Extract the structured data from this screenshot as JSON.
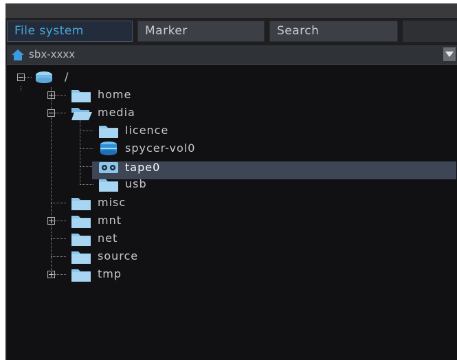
{
  "tabs": [
    {
      "label": "File system",
      "active": true
    },
    {
      "label": "Marker",
      "active": false
    },
    {
      "label": "Search",
      "active": false
    }
  ],
  "path_bar": {
    "label": "sbx-xxxx",
    "icon": "home-icon"
  },
  "tree": {
    "root": {
      "label": "/",
      "icon": "drive-icon",
      "expanded": true
    },
    "items": [
      {
        "label": "home",
        "icon": "folder-icon",
        "expander": "plus"
      },
      {
        "label": "media",
        "icon": "folder-open-icon",
        "expander": "minus"
      },
      {
        "label": "licence",
        "icon": "folder-icon"
      },
      {
        "label": "spycer-vol0",
        "icon": "volume-icon"
      },
      {
        "label": "tape0",
        "icon": "tape-icon",
        "selected": true
      },
      {
        "label": "usb",
        "icon": "folder-icon"
      },
      {
        "label": "misc",
        "icon": "folder-icon"
      },
      {
        "label": "mnt",
        "icon": "folder-icon",
        "expander": "plus"
      },
      {
        "label": "net",
        "icon": "folder-icon"
      },
      {
        "label": "source",
        "icon": "folder-icon"
      },
      {
        "label": "tmp",
        "icon": "folder-icon",
        "expander": "plus"
      }
    ]
  },
  "colors": {
    "accent": "#4aa7e0",
    "folder": "#8cc6ea",
    "selection": "#3e4656"
  }
}
